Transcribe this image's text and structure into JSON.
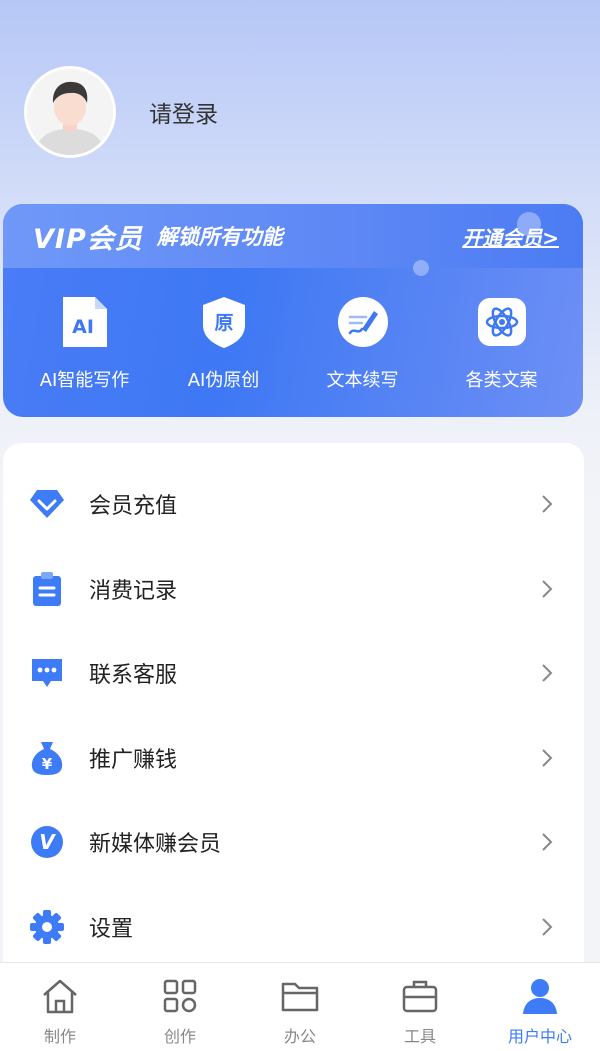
{
  "profile": {
    "login_text": "请登录"
  },
  "vip": {
    "title": "VIP会员",
    "subtitle": "解锁所有功能",
    "open_label": "开通会员>",
    "features": [
      {
        "label": "AI智能写作",
        "icon": "ai-doc-icon",
        "icon_text": "AI"
      },
      {
        "label": "AI伪原创",
        "icon": "original-shield-icon",
        "icon_text": "原"
      },
      {
        "label": "文本续写",
        "icon": "pen-write-icon"
      },
      {
        "label": "各类文案",
        "icon": "atom-icon"
      }
    ]
  },
  "menu": {
    "items": [
      {
        "label": "会员充值",
        "icon": "diamond-icon"
      },
      {
        "label": "消费记录",
        "icon": "clipboard-icon"
      },
      {
        "label": "联系客服",
        "icon": "chat-bubble-icon"
      },
      {
        "label": "推广赚钱",
        "icon": "money-bag-icon",
        "icon_text": "¥"
      },
      {
        "label": "新媒体赚会员",
        "icon": "v-circle-icon",
        "icon_text": "V"
      },
      {
        "label": "设置",
        "icon": "gear-icon"
      }
    ]
  },
  "tabbar": {
    "tabs": [
      {
        "label": "制作",
        "icon": "home-icon"
      },
      {
        "label": "创作",
        "icon": "grid-apps-icon"
      },
      {
        "label": "办公",
        "icon": "folder-icon"
      },
      {
        "label": "工具",
        "icon": "toolbox-icon"
      },
      {
        "label": "用户中心",
        "icon": "user-icon",
        "active": true
      }
    ]
  },
  "colors": {
    "accent": "#3e7bf7",
    "vip_blue": "#4a7cf6",
    "text": "#222222"
  }
}
